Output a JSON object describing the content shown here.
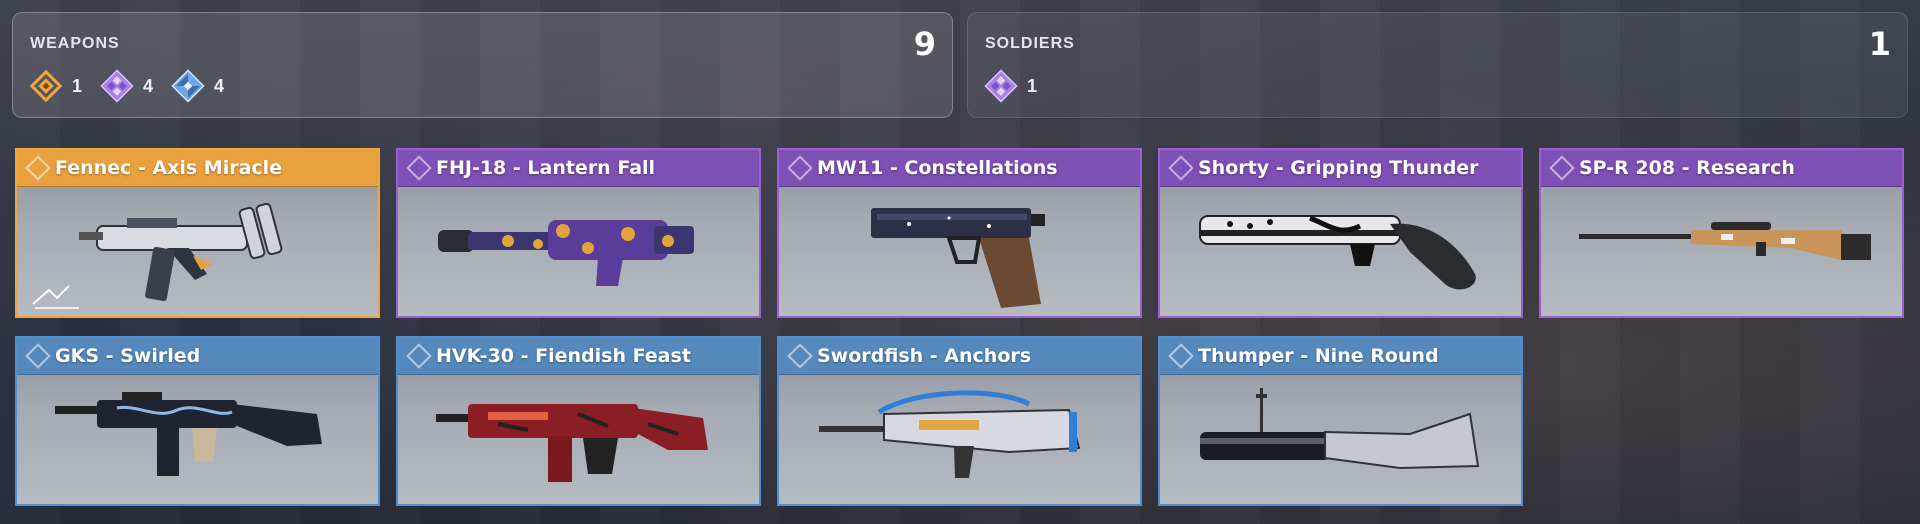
{
  "weapons_summary": {
    "label": "WEAPONS",
    "total": "9",
    "counts": [
      {
        "rarity": "legendary",
        "icon": "legendary-gem-icon",
        "count": "1",
        "color": "#f2a43b"
      },
      {
        "rarity": "epic",
        "icon": "epic-gem-icon",
        "count": "4",
        "color": "#a97fe8"
      },
      {
        "rarity": "rare",
        "icon": "rare-gem-icon",
        "count": "4",
        "color": "#6ea6e6"
      }
    ]
  },
  "soldiers_summary": {
    "label": "SOLDIERS",
    "total": "1",
    "counts": [
      {
        "rarity": "epic",
        "icon": "epic-gem-icon",
        "count": "1",
        "color": "#a97fe8"
      }
    ]
  },
  "items": [
    {
      "title": "Fennec - Axis Miracle",
      "rarity": "legendary",
      "weapon": "smg"
    },
    {
      "title": "FHJ-18 - Lantern Fall",
      "rarity": "epic",
      "weapon": "launcher"
    },
    {
      "title": "MW11 - Constellations",
      "rarity": "epic",
      "weapon": "pistol"
    },
    {
      "title": "Shorty - Gripping Thunder",
      "rarity": "epic",
      "weapon": "shotgun"
    },
    {
      "title": "SP-R 208 - Research",
      "rarity": "epic",
      "weapon": "rifle"
    },
    {
      "title": "GKS - Swirled",
      "rarity": "rare",
      "weapon": "smg-compact"
    },
    {
      "title": "HVK-30 - Fiendish Feast",
      "rarity": "rare",
      "weapon": "assault-rifle"
    },
    {
      "title": "Swordfish - Anchors",
      "rarity": "rare",
      "weapon": "burst-rifle"
    },
    {
      "title": "Thumper - Nine Round",
      "rarity": "rare",
      "weapon": "grenade-launcher"
    }
  ],
  "colors": {
    "legendary": "#e9a03f",
    "epic": "#7e4fb4",
    "rare": "#5588bb"
  }
}
